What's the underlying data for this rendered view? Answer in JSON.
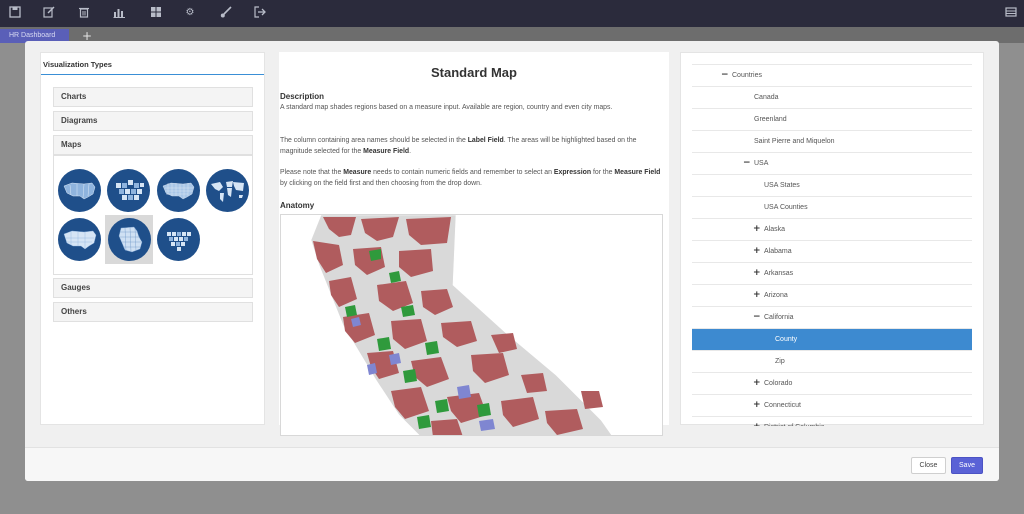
{
  "topbar": {
    "icons": [
      "save-icon",
      "edit-icon",
      "trash-icon",
      "bar-chart-icon",
      "grid-icon",
      "gear-icon",
      "brush-icon",
      "exit-icon",
      "panel-icon"
    ]
  },
  "tabs": {
    "dashboard_label": "HR Dashboard",
    "add_label": "+"
  },
  "left": {
    "title": "Visualization Types",
    "sections": [
      "Charts",
      "Diagrams",
      "Maps",
      "Gauges",
      "Others"
    ],
    "map_thumbnails": [
      "US states map",
      "US tile map",
      "US counties map",
      "World map",
      "US map",
      "State county map",
      "US hex tile map"
    ],
    "selected_thumbnail": 5
  },
  "center": {
    "title": "Standard Map",
    "description_heading": "Description",
    "p1": "A standard map shades regions based on a measure input. Available are region, country and even city maps.",
    "p2_a": "The column containing area names should be selected in the ",
    "p2_b": "Label Field",
    "p2_c": ". The areas will be highlighted based on the magnitude selected for the ",
    "p2_d": "Measure Field",
    "p2_e": ".",
    "p3_a": "Please note that the ",
    "p3_b": "Measure",
    "p3_c": " needs to contain numeric fields and remember to select an ",
    "p3_d": "Expression",
    "p3_e": " for the ",
    "p3_f": "Measure Field",
    "p3_g": " by clicking on the field first and then choosing from the drop down.",
    "anatomy_heading": "Anatomy",
    "map_colors": {
      "primary": "#b05c5e",
      "secondary": "#2f9a3c",
      "tertiary": "#7f86d1",
      "base": "#d9d9d9"
    }
  },
  "tree": {
    "nodes": [
      {
        "label": "",
        "sign": "",
        "level": 0
      },
      {
        "label": "Countries",
        "sign": "−",
        "level": 1
      },
      {
        "label": "Canada",
        "sign": "",
        "level": 2
      },
      {
        "label": "Greenland",
        "sign": "",
        "level": 2
      },
      {
        "label": "Saint Pierre and Miquelon",
        "sign": "",
        "level": 2
      },
      {
        "label": "USA",
        "sign": "−",
        "level": 2
      },
      {
        "label": "USA States",
        "sign": "",
        "level": 3
      },
      {
        "label": "USA Counties",
        "sign": "",
        "level": 3
      },
      {
        "label": "Alaska",
        "sign": "+",
        "level": 3
      },
      {
        "label": "Alabama",
        "sign": "+",
        "level": 3
      },
      {
        "label": "Arkansas",
        "sign": "+",
        "level": 3
      },
      {
        "label": "Arizona",
        "sign": "+",
        "level": 3
      },
      {
        "label": "California",
        "sign": "−",
        "level": 3
      },
      {
        "label": "County",
        "sign": "",
        "level": 4
      },
      {
        "label": "Zip",
        "sign": "",
        "level": 4
      },
      {
        "label": "Colorado",
        "sign": "+",
        "level": 3
      },
      {
        "label": "Connecticut",
        "sign": "+",
        "level": 3
      },
      {
        "label": "District of Columbia",
        "sign": "+",
        "level": 3
      }
    ],
    "selected_index": 13
  },
  "footer": {
    "close_label": "Close",
    "save_label": "Save"
  }
}
